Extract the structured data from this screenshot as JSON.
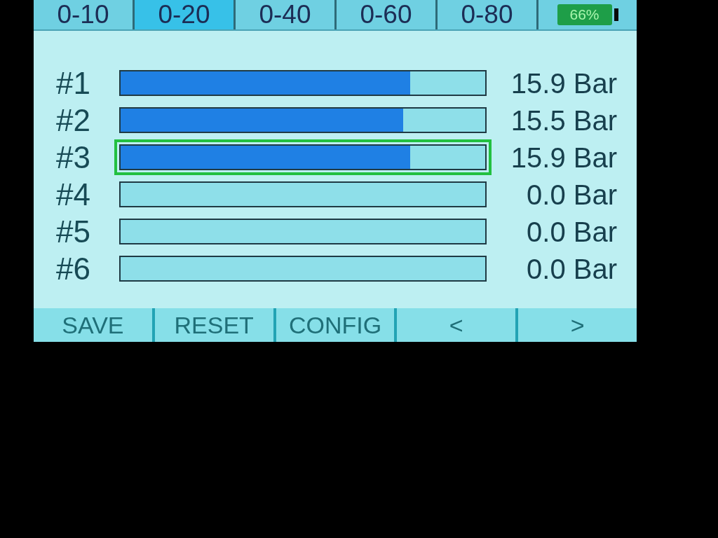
{
  "tabs": [
    {
      "label": "0-10",
      "selected": false
    },
    {
      "label": "0-20",
      "selected": true
    },
    {
      "label": "0-40",
      "selected": false
    },
    {
      "label": "0-60",
      "selected": false
    },
    {
      "label": "0-80",
      "selected": false
    }
  ],
  "battery": {
    "text": "66%"
  },
  "channels": [
    {
      "label": "#1",
      "level": 0.795,
      "reading": "15.9 Bar",
      "selected": false
    },
    {
      "label": "#2",
      "level": 0.775,
      "reading": "15.5 Bar",
      "selected": false
    },
    {
      "label": "#3",
      "level": 0.795,
      "reading": "15.9 Bar",
      "selected": true
    },
    {
      "label": "#4",
      "level": 0,
      "reading": "0.0 Bar",
      "selected": false
    },
    {
      "label": "#5",
      "level": 0,
      "reading": "0.0 Bar",
      "selected": false
    },
    {
      "label": "#6",
      "level": 0,
      "reading": "0.0 Bar",
      "selected": false
    }
  ],
  "buttons": [
    "SAVE",
    "RESET",
    "CONFIG",
    "<",
    ">"
  ]
}
